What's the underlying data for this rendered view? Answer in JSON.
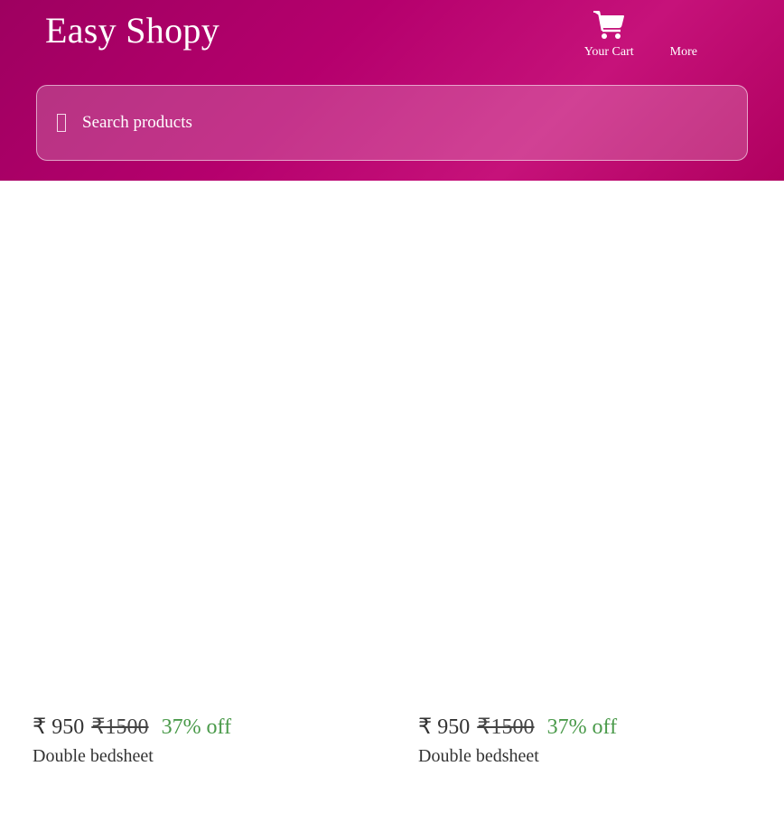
{
  "header": {
    "brand": "Easy Shopy",
    "nav": {
      "cart_label": "Your Cart",
      "more_label": "More"
    },
    "search": {
      "placeholder": "Search products"
    }
  },
  "products": [
    {
      "currency": "₹",
      "price": "₹ 950",
      "original_price": "₹1500",
      "discount": "37% off",
      "name": "Double bedsheet"
    },
    {
      "currency": "₹",
      "price": "₹ 950",
      "original_price": "₹1500",
      "discount": "37% off",
      "name": "Double bedsheet"
    }
  ],
  "colors": {
    "header_gradient_start": "#9e0060",
    "header_gradient_end": "#c6127a",
    "discount": "#4a9a4a"
  }
}
